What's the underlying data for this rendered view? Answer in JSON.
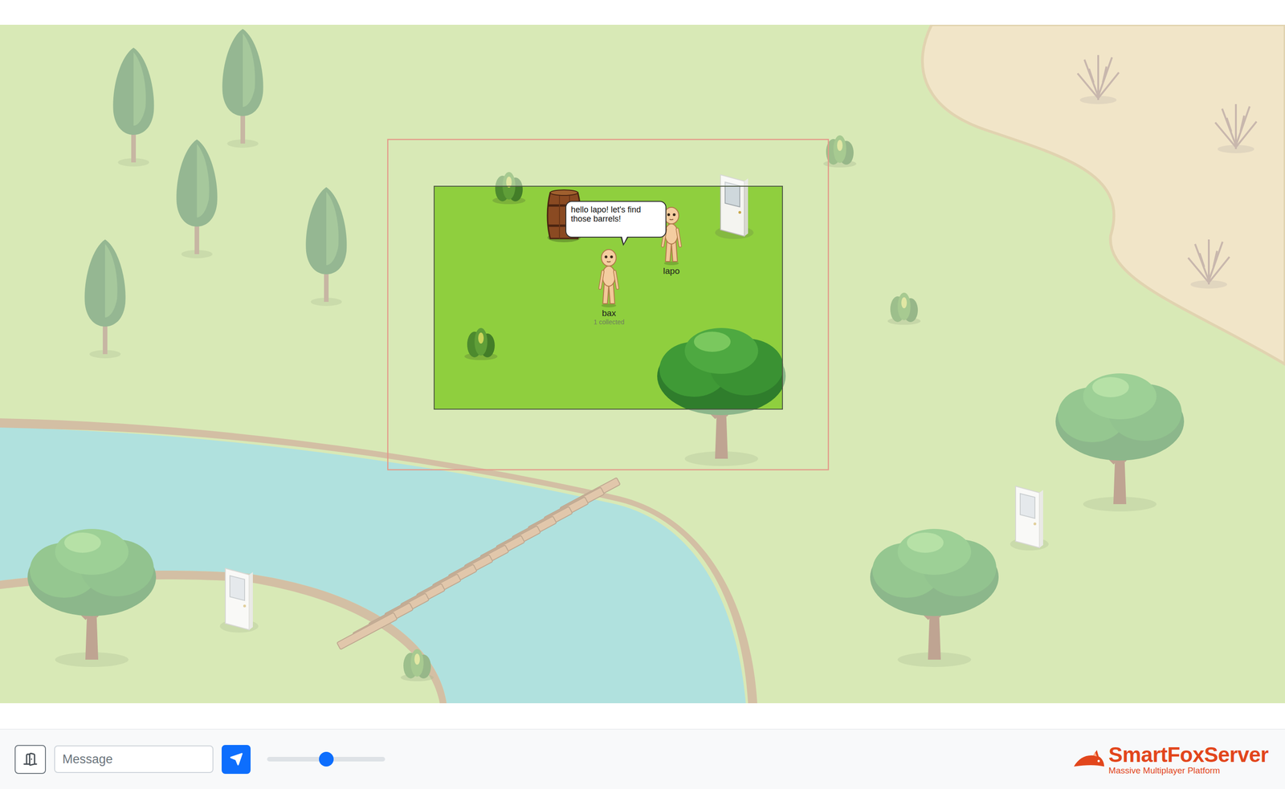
{
  "scene": {
    "bubble": {
      "speaker": "bax",
      "text": "hello lapo! let's find those barrels!"
    },
    "avatars": [
      {
        "name": "lapo"
      },
      {
        "name": "bax",
        "status": "1 collected"
      }
    ]
  },
  "toolbar": {
    "message": {
      "placeholder": "Message"
    },
    "zoom": {
      "level": 0.5
    }
  },
  "logo": {
    "name": "SmartFoxServer",
    "tagline": "Massive Multiplayer Platform"
  }
}
